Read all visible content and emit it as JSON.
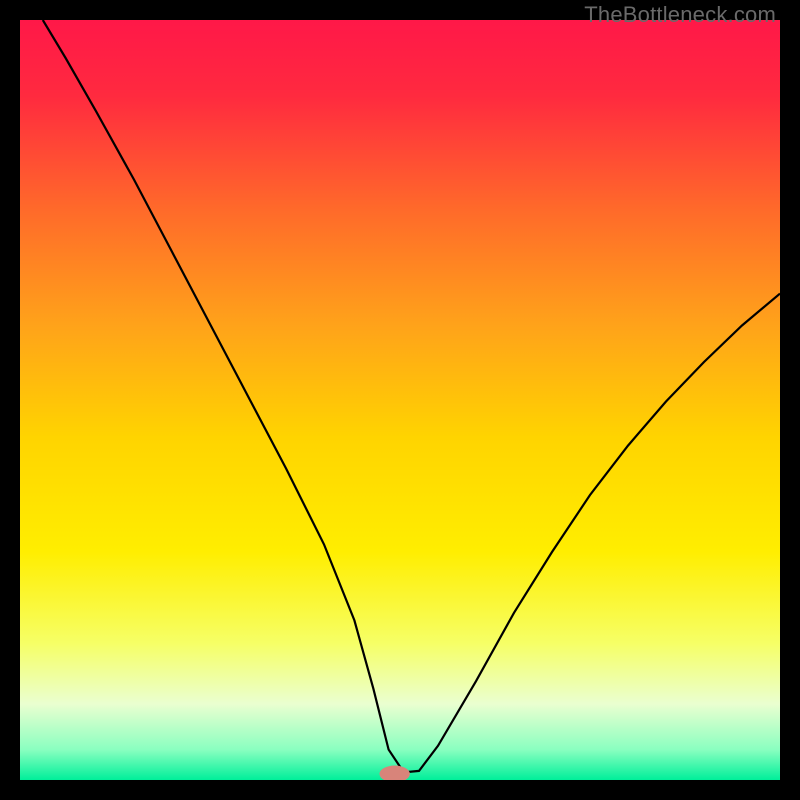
{
  "watermark": "TheBottleneck.com",
  "chart_data": {
    "type": "line",
    "title": "",
    "xlabel": "",
    "ylabel": "",
    "xlim": [
      0,
      100
    ],
    "ylim": [
      0,
      100
    ],
    "gradient_stops": [
      {
        "offset": 0.0,
        "color": "#ff1848"
      },
      {
        "offset": 0.1,
        "color": "#ff2a3f"
      },
      {
        "offset": 0.25,
        "color": "#ff6a2a"
      },
      {
        "offset": 0.4,
        "color": "#ffa21a"
      },
      {
        "offset": 0.55,
        "color": "#ffd400"
      },
      {
        "offset": 0.7,
        "color": "#ffee00"
      },
      {
        "offset": 0.82,
        "color": "#f6ff66"
      },
      {
        "offset": 0.9,
        "color": "#eaffd0"
      },
      {
        "offset": 0.96,
        "color": "#8affc0"
      },
      {
        "offset": 1.0,
        "color": "#00ef9a"
      }
    ],
    "marker": {
      "x": 49.3,
      "y": 0.8,
      "color": "#d8847a",
      "rx": 2.0,
      "ry": 1.1
    },
    "series": [
      {
        "name": "bottleneck-curve",
        "x": [
          3,
          6,
          10,
          15,
          20,
          25,
          30,
          35,
          40,
          44,
          46.5,
          48.5,
          50.5,
          52.5,
          55,
          60,
          65,
          70,
          75,
          80,
          85,
          90,
          95,
          100
        ],
        "y": [
          100,
          95,
          88,
          79,
          69.5,
          60,
          50.5,
          41,
          31,
          21,
          12,
          4,
          1,
          1.2,
          4.5,
          13,
          22,
          30,
          37.5,
          44,
          49.8,
          55,
          59.8,
          64
        ]
      }
    ]
  }
}
